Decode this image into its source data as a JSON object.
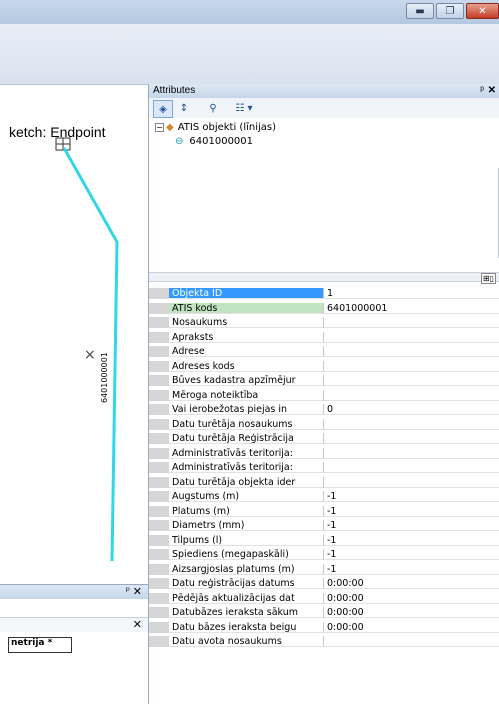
{
  "window": {
    "minimize_icon": "minimize-icon",
    "maximize_icon": "maximize-icon",
    "close_icon": "close-icon"
  },
  "map": {
    "sketch_label": "ketch: Endpoint",
    "feature_label": "6401000001",
    "cross_mark": "×",
    "line_color": "#33d6e6"
  },
  "attributes_panel": {
    "title": "Attributes",
    "pin_glyph": "ᵖ",
    "close_glyph": "✕",
    "tree": {
      "layer_name": "ATIS objekti (līnijas)",
      "feature_id": "6401000001"
    },
    "rows": [
      {
        "name": "Objekta ID",
        "value": "1",
        "state": "selected"
      },
      {
        "name": "ATIS kods",
        "value": "6401000001",
        "state": "green"
      },
      {
        "name": "Nosaukums",
        "value": ""
      },
      {
        "name": "Apraksts",
        "value": ""
      },
      {
        "name": "Adrese",
        "value": ""
      },
      {
        "name": "Adreses kods",
        "value": ""
      },
      {
        "name": "Būves kadastra apzīmējur",
        "value": ""
      },
      {
        "name": "Mēroga noteiktība",
        "value": ""
      },
      {
        "name": "Vai ierobežotas piejas in",
        "value": "0"
      },
      {
        "name": "Datu turētāja nosaukums",
        "value": ""
      },
      {
        "name": "Datu turētāja Reģistrācija",
        "value": ""
      },
      {
        "name": "Administratīvās teritorija:",
        "value": ""
      },
      {
        "name": "Administratīvās teritorija:",
        "value": ""
      },
      {
        "name": "Datu turētāja objekta ider",
        "value": ""
      },
      {
        "name": "Augstums (m)",
        "value": "-1"
      },
      {
        "name": "Platums (m)",
        "value": "-1"
      },
      {
        "name": "Diametrs (mm)",
        "value": "-1"
      },
      {
        "name": "Tilpums (l)",
        "value": "-1"
      },
      {
        "name": "Spiediens (megapaskāli)",
        "value": "-1"
      },
      {
        "name": "Aizsargjoslas platums (m)",
        "value": "-1"
      },
      {
        "name": "Datu reģistrācijas datums",
        "value": "0:00:00"
      },
      {
        "name": "Pēdējās aktualizācijas dat",
        "value": "0:00:00"
      },
      {
        "name": "Datubāzes ieraksta sākum",
        "value": "0:00:00"
      },
      {
        "name": "Datu bāzes ieraksta beigu",
        "value": "0:00:00"
      },
      {
        "name": "Datu avota nosaukums",
        "value": ""
      }
    ]
  },
  "bottom_panel": {
    "pin_glyph": "ᵖ",
    "close_glyph": "✕",
    "geometry_tab": "netrija *"
  }
}
